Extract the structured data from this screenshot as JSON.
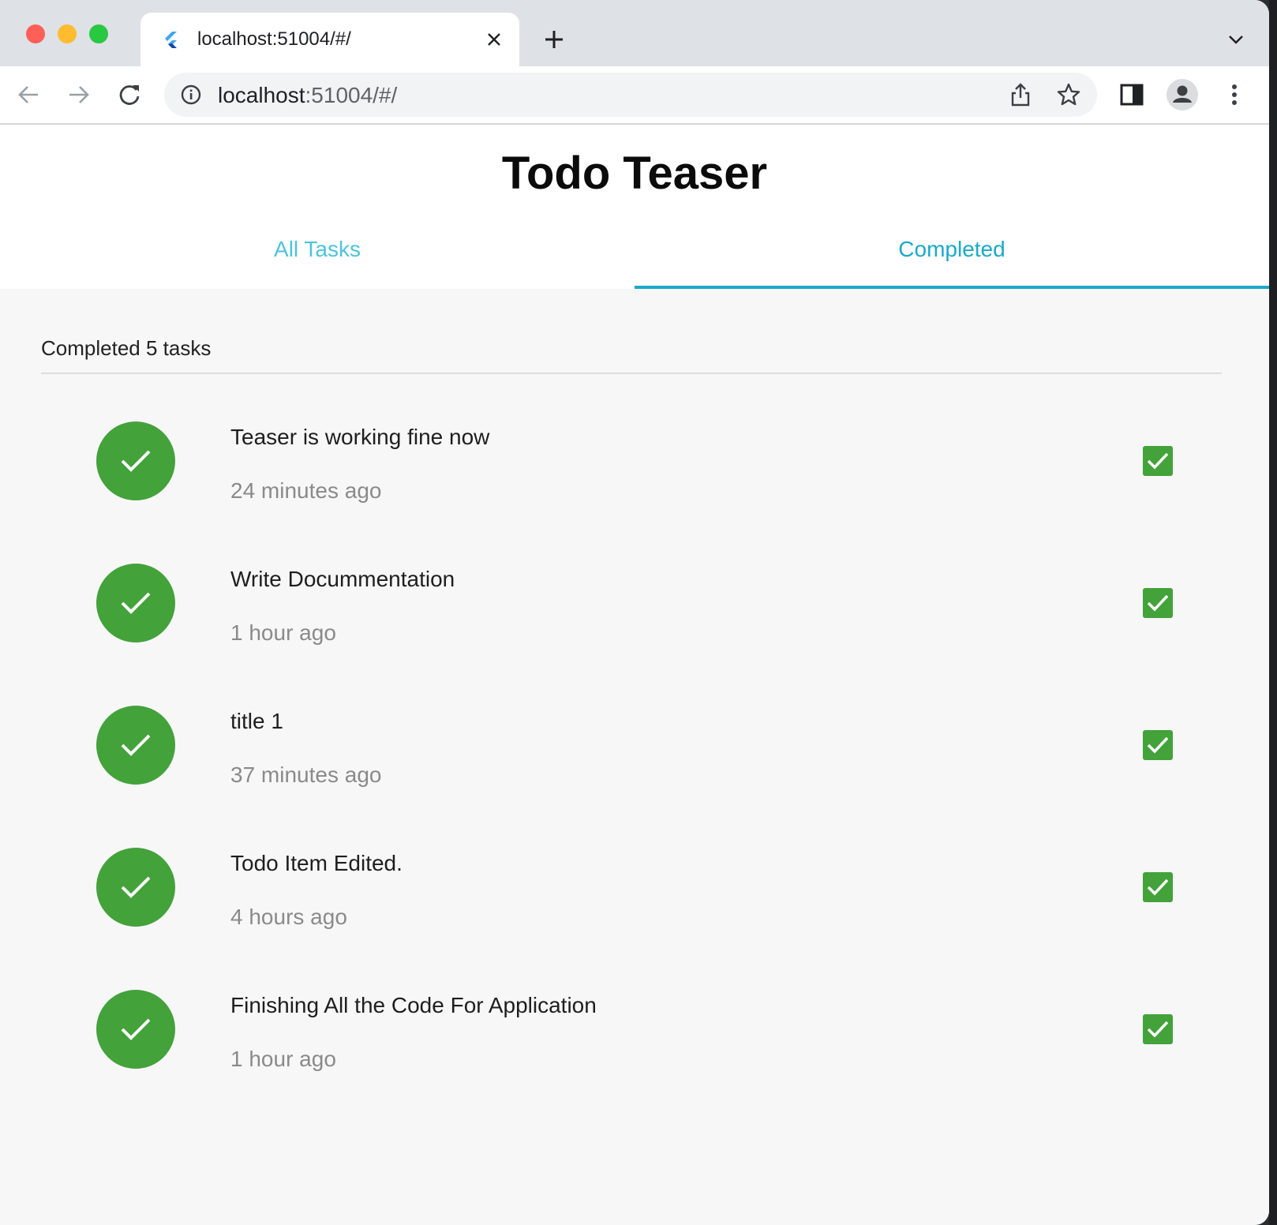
{
  "browser": {
    "tab_title": "localhost:51004/#/",
    "url_host": "localhost",
    "url_rest": ":51004/#/"
  },
  "app": {
    "title": "Todo Teaser",
    "tabs": [
      {
        "label": "All Tasks",
        "selected": false
      },
      {
        "label": "Completed",
        "selected": true
      }
    ],
    "summary": "Completed 5 tasks",
    "tasks": [
      {
        "title": "Teaser is working fine now",
        "time": "24 minutes ago",
        "completed": true
      },
      {
        "title": "Write Docummentation",
        "time": "1 hour ago",
        "completed": true
      },
      {
        "title": "title 1",
        "time": "37 minutes ago",
        "completed": true
      },
      {
        "title": "Todo Item Edited.",
        "time": "4 hours ago",
        "completed": true
      },
      {
        "title": "Finishing All the Code For Application",
        "time": "1 hour ago",
        "completed": true
      }
    ]
  },
  "colors": {
    "accent": "#1aa9c9",
    "done_green": "#43a23a"
  }
}
